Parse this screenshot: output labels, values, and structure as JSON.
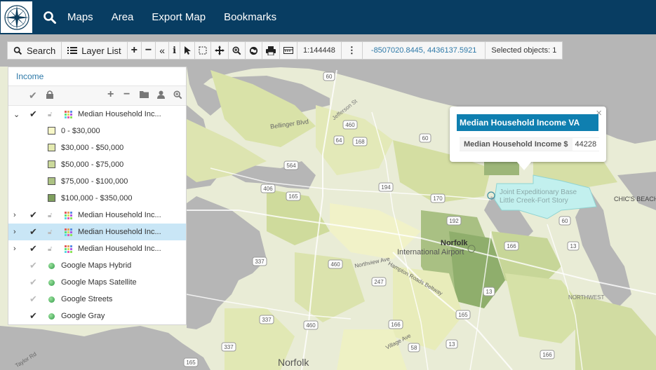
{
  "nav": {
    "items": [
      "Maps",
      "Area",
      "Export Map",
      "Bookmarks"
    ]
  },
  "toolbar": {
    "search_label": "Search",
    "layer_list_label": "Layer List",
    "scale": "1:144448",
    "coordinates": "-8507020.8445, 4436137.5921",
    "selected": "Selected objects: 1"
  },
  "panel": {
    "title": "Income",
    "layers": [
      {
        "name": "Median Household Inc...",
        "expanded": true,
        "checked": true,
        "selected": false
      },
      {
        "name": "Median Household Inc...",
        "expanded": false,
        "checked": true,
        "selected": false
      },
      {
        "name": "Median Household Inc...",
        "expanded": false,
        "checked": true,
        "selected": true
      },
      {
        "name": "Median Household Inc...",
        "expanded": false,
        "checked": true,
        "selected": false
      }
    ],
    "legend": [
      {
        "label": "0 - $30,000",
        "color": "#f7f7c8"
      },
      {
        "label": "$30,000 - $50,000",
        "color": "#e4eab0"
      },
      {
        "label": "$50,000 - $75,000",
        "color": "#cbd99b"
      },
      {
        "label": "$75,000 - $100,000",
        "color": "#acc283"
      },
      {
        "label": "$100,000 - $350,000",
        "color": "#7f9f5e"
      }
    ],
    "basemaps": [
      {
        "name": "Google Maps Hybrid",
        "checked": false
      },
      {
        "name": "Google Maps Satellite",
        "checked": false
      },
      {
        "name": "Google Streets",
        "checked": false
      },
      {
        "name": "Google Gray",
        "checked": true
      }
    ]
  },
  "popup": {
    "title": "Median Household Income VA",
    "key": "Median Household Income $",
    "value": "44228"
  },
  "map_labels": {
    "norfolk_airport": "Norfolk International Airport",
    "norfolk_intl": "International Airport",
    "norfolk": "Norfolk",
    "norfolk_city": "Norfolk",
    "bellinger": "Bellinger Blvd",
    "jefferson": "Jefferson St",
    "northview": "Northview Ave",
    "hampton": "Hampton Roads Beltway",
    "village": "Village Ave",
    "taylor": "Taylor Rd",
    "northwest": "NORTHWEST",
    "chics": "CHIC'S BEACH",
    "joint": "Joint Expeditionary Base Little Creek-Fort Story",
    "routes": [
      "60",
      "460",
      "64",
      "168",
      "564",
      "406",
      "165",
      "194",
      "170",
      "60",
      "192",
      "166",
      "13",
      "337",
      "460",
      "247",
      "13",
      "166",
      "165",
      "337",
      "460",
      "58",
      "13",
      "166",
      "60",
      "165",
      "337"
    ]
  },
  "colors": {
    "header": "#083d62",
    "water": "#b6b6b6",
    "land_base": "#e9ecd6",
    "highlight": "#c2f0ee",
    "accent": "#2d79a8"
  }
}
